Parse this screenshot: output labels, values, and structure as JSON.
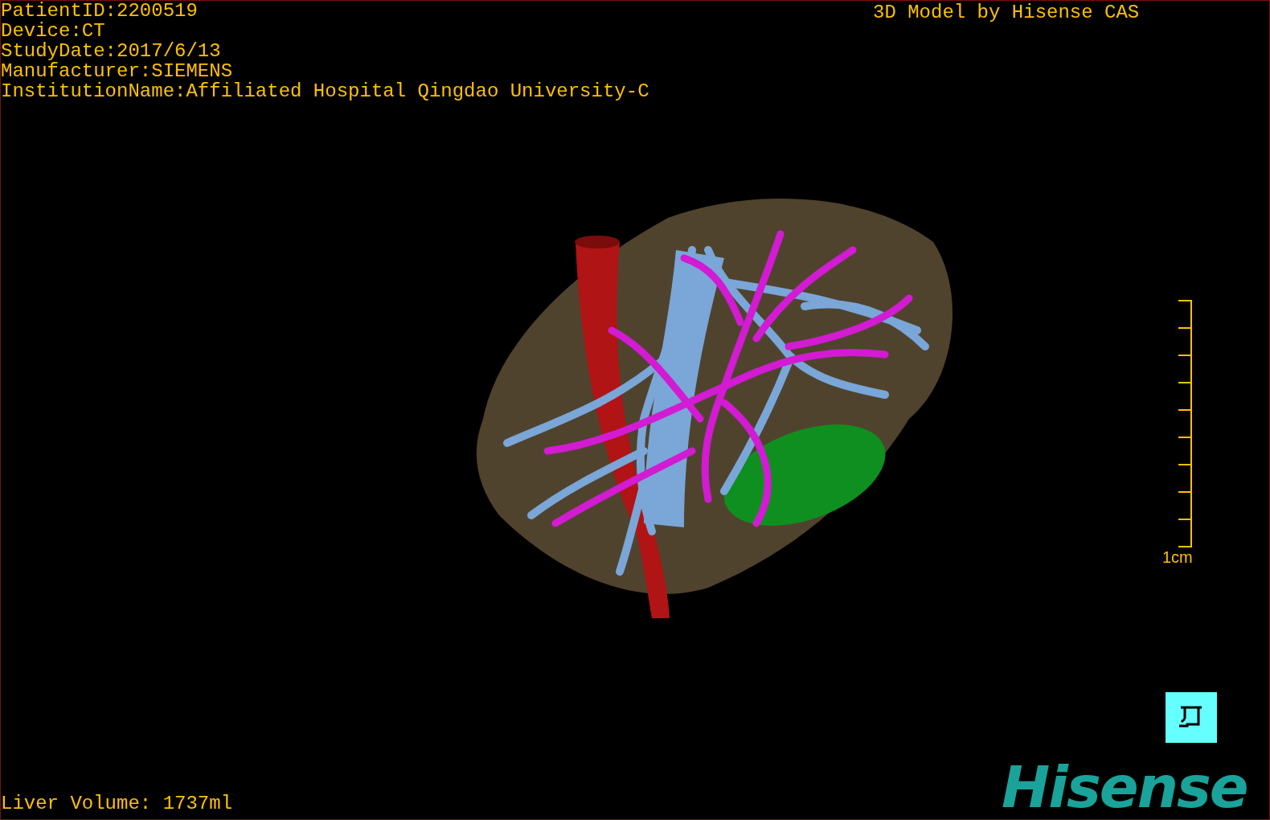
{
  "patient_info": [
    "PatientID:2200519",
    "Device:CT",
    "StudyDate:2017/6/13",
    "Manufacturer:SIEMENS",
    "InstitutionName:Affiliated Hospital Qingdao University-C"
  ],
  "title": "3D Model by Hisense CAS",
  "scale_label": "1cm",
  "liver_volume": "Liver Volume: 1737ml",
  "logo": "Hisense"
}
